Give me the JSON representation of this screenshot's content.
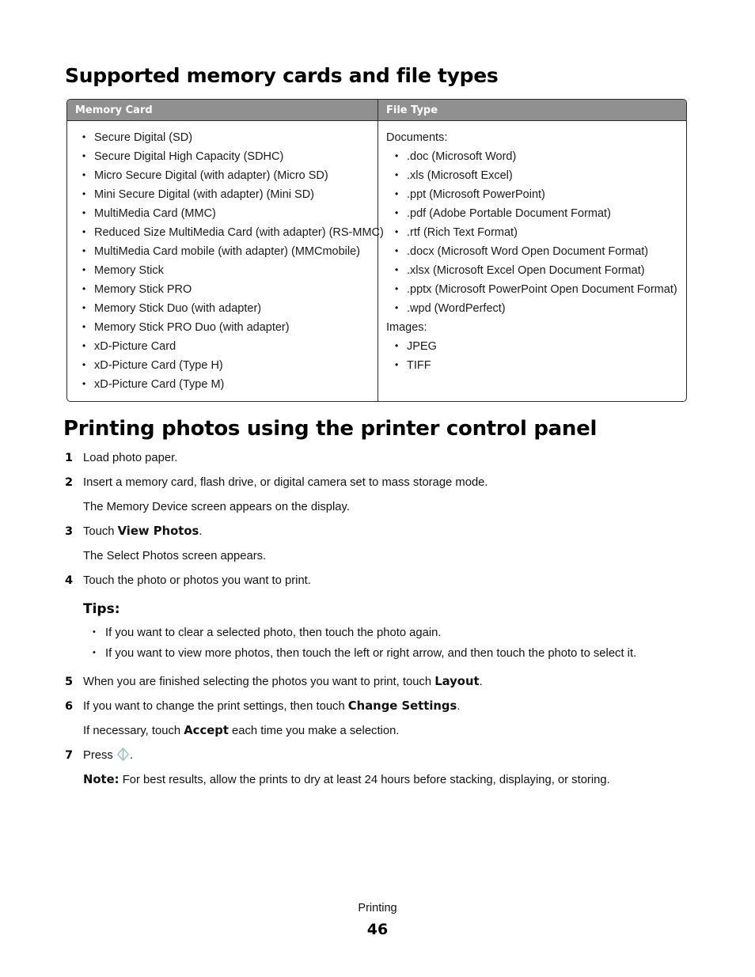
{
  "document": {
    "heading_1": "Supported memory cards and file types",
    "heading_2": "Printing photos using the printer control panel"
  },
  "table": {
    "header": {
      "memory_card": "Memory Card",
      "file_type": "File Type"
    },
    "header_bg_color": "#909090",
    "header_text_color": "#ffffff",
    "border_color": "#2b2b2b",
    "memory_cards": [
      "Secure Digital (SD)",
      "Secure Digital High Capacity (SDHC)",
      "Micro Secure Digital (with adapter) (Micro SD)",
      "Mini Secure Digital (with adapter) (Mini SD)",
      "MultiMedia Card (MMC)",
      "Reduced Size MultiMedia Card (with adapter) (RS-MMC)",
      "MultiMedia Card mobile (with adapter) (MMCmobile)",
      "Memory Stick",
      "Memory Stick PRO",
      "Memory Stick Duo (with adapter)",
      "Memory Stick PRO Duo (with adapter)",
      "xD-Picture Card",
      "xD-Picture Card (Type H)",
      "xD-Picture Card (Type M)"
    ],
    "file_types": {
      "documents_label": "Documents:",
      "documents": [
        ".doc (Microsoft Word)",
        ".xls (Microsoft Excel)",
        ".ppt (Microsoft PowerPoint)",
        ".pdf (Adobe Portable Document Format)",
        ".rtf (Rich Text Format)",
        ".docx (Microsoft Word Open Document Format)",
        ".xlsx (Microsoft Excel Open Document Format)",
        ".pptx (Microsoft PowerPoint Open Document Format)",
        ".wpd (WordPerfect)"
      ],
      "images_label": "Images:",
      "images": [
        "JPEG",
        "TIFF"
      ]
    }
  },
  "procedure": {
    "step1": {
      "num": "1",
      "text": "Load photo paper."
    },
    "step2": {
      "num": "2",
      "text": "Insert a memory card, flash drive, or digital camera set to mass storage mode.",
      "result": "The Memory Device screen appears on the display."
    },
    "step3": {
      "num": "3",
      "prefix": "Touch ",
      "bold": "View Photos",
      "suffix": ".",
      "result": "The Select Photos screen appears."
    },
    "step4": {
      "num": "4",
      "text": "Touch the photo or photos you want to print."
    },
    "tips": {
      "heading": "Tips:",
      "items": [
        "If you want to clear a selected photo, then touch the photo again.",
        "If you want to view more photos, then touch the left or right arrow, and then touch the photo to select it."
      ]
    },
    "step5": {
      "num": "5",
      "prefix": "When you are finished selecting the photos you want to print, touch ",
      "bold": "Layout",
      "suffix": "."
    },
    "step6": {
      "num": "6",
      "prefix": "If you want to change the print settings, then touch ",
      "bold": "Change Settings",
      "suffix": ".",
      "note_prefix": "If necessary, touch ",
      "note_bold": "Accept",
      "note_suffix": " each time you make a selection."
    },
    "step7": {
      "num": "7",
      "prefix": "Press ",
      "icon": "start-button-icon",
      "suffix": ".",
      "note_label": "Note:",
      "note_text": " For best results, allow the prints to dry at least 24 hours before stacking, displaying, or storing."
    }
  },
  "footer": {
    "section": "Printing",
    "page_number": "46"
  }
}
